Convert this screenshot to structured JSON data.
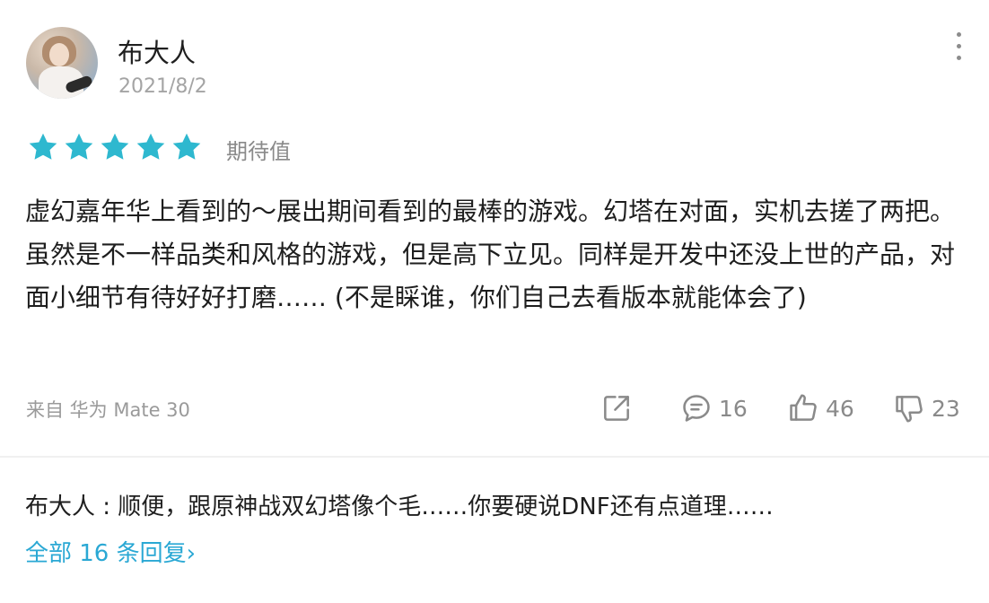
{
  "review": {
    "user": {
      "name": "布大人",
      "date": "2021/8/2"
    },
    "rating": {
      "stars": 5,
      "max": 5,
      "label": "期待值"
    },
    "content": "虚幻嘉年华上看到的～展出期间看到的最棒的游戏。幻塔在对面，实机去搓了两把。虽然是不一样品类和风格的游戏，但是高下立见。同样是开发中还没上世的产品，对面小细节有待好好打磨…… (不是睬谁，你们自己去看版本就能体会了)",
    "device": "来自 华为 Mate 30",
    "actions": {
      "share_icon": "share-icon",
      "comments": "16",
      "likes": "46",
      "dislikes": "23"
    }
  },
  "reply": {
    "author": "布大人",
    "text": "布大人 : 顺便，跟原神战双幻塔像个毛……你要硬说DNF还有点道理……"
  },
  "all_replies_link": "全部 16 条回复",
  "colors": {
    "star": "#2eb8cf",
    "link": "#2aa8d4",
    "icon": "#8a8a8a"
  }
}
